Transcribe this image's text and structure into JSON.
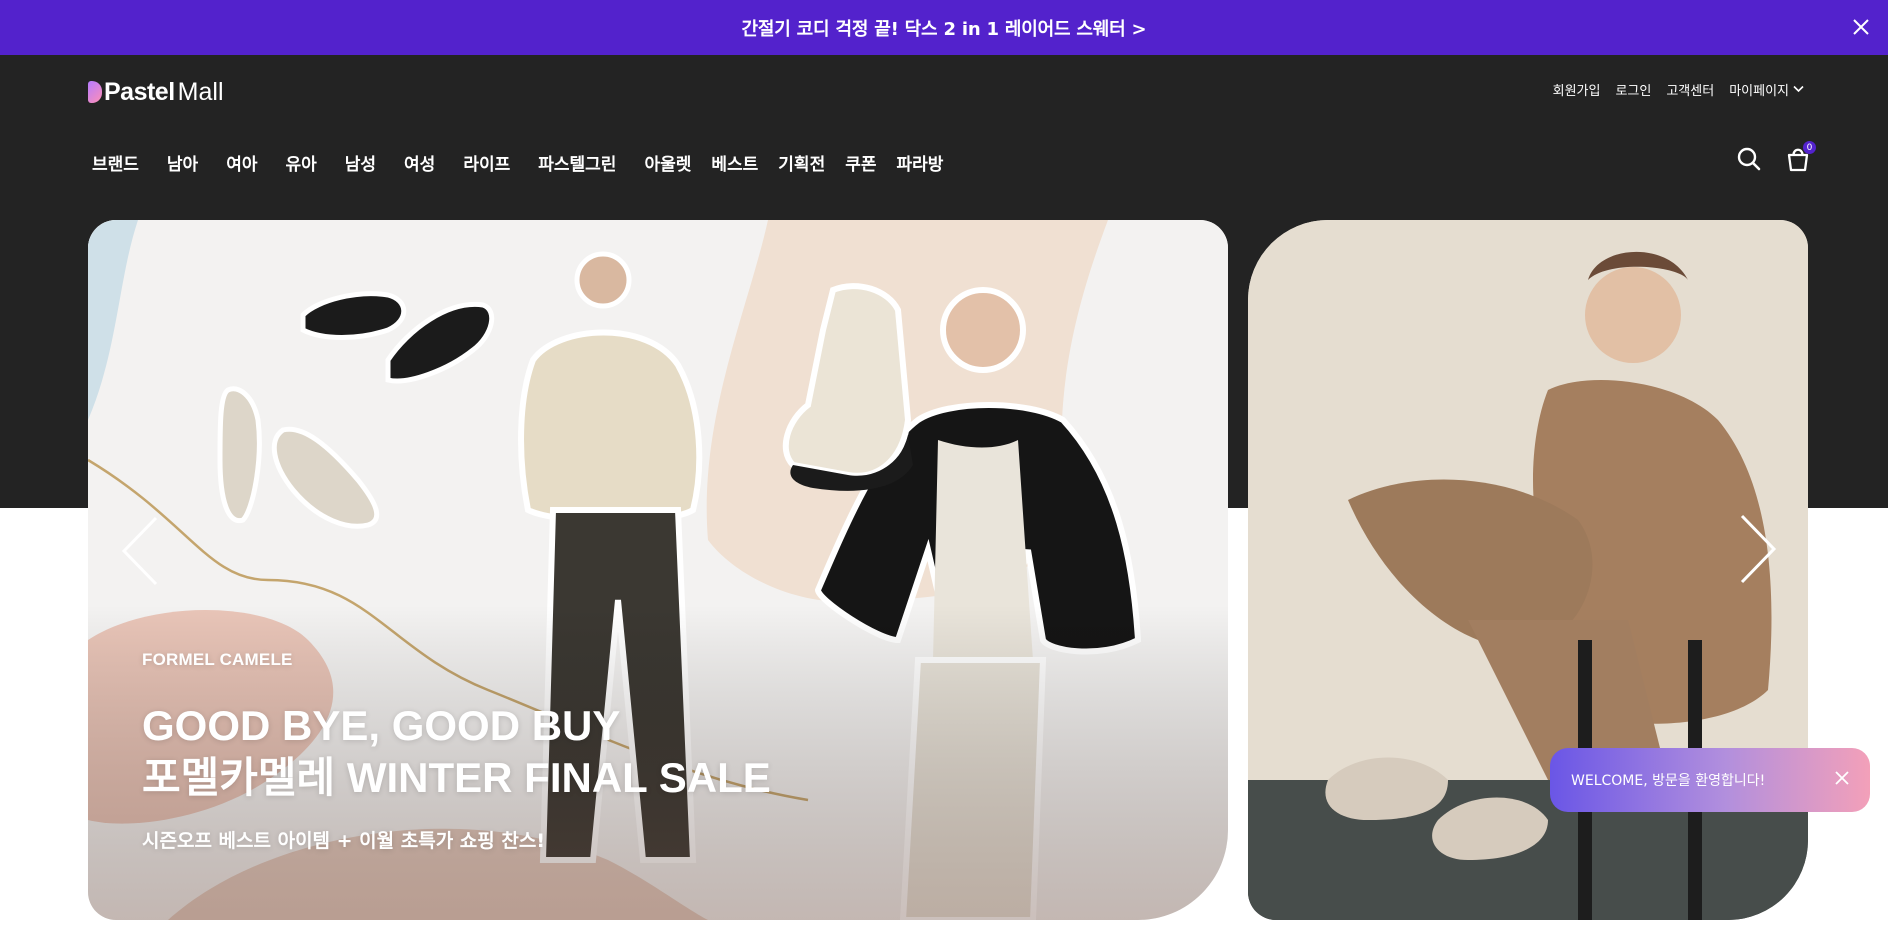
{
  "promo_bar": {
    "text": "간절기 코디 걱정 끝! 닥스 2 in 1 레이어드 스웨터 >"
  },
  "logo": {
    "pastel": "Pastel",
    "mall": "Mall"
  },
  "utility_nav": [
    {
      "label": "회원가입"
    },
    {
      "label": "로그인"
    },
    {
      "label": "고객센터"
    },
    {
      "label": "마이페이지"
    }
  ],
  "main_nav": [
    {
      "label": "브랜드"
    },
    {
      "label": "남아"
    },
    {
      "label": "여아"
    },
    {
      "label": "유아"
    },
    {
      "label": "남성"
    },
    {
      "label": "여성"
    },
    {
      "label": "라이프"
    },
    {
      "label": "파스텔그린"
    },
    {
      "label": "아울렛"
    },
    {
      "label": "베스트"
    },
    {
      "label": "기획전"
    },
    {
      "label": "쿠폰"
    },
    {
      "label": "파라방"
    }
  ],
  "cart": {
    "count": "0"
  },
  "hero": {
    "brand": "FORMEL CAMELE",
    "title_line1": "GOOD BYE, GOOD BUY",
    "title_line2": "포멜카멜레 WINTER FINAL SALE",
    "subtitle": "시즌오프 베스트 아이템 + 이월 초특가 쇼핑 찬스!"
  },
  "toast": {
    "text": "WELCOME, 방문을 환영합니다!"
  },
  "icons": {
    "search": "search-icon",
    "cart": "shopping-bag-icon",
    "close": "close-icon",
    "prev": "chevron-left-icon",
    "next": "chevron-right-icon",
    "dropdown": "chevron-down-icon"
  },
  "colors": {
    "promo_bg": "#5322cc",
    "header_bg": "#232323",
    "badge": "#5322cc",
    "toast_start": "#6a56e6",
    "toast_end": "#f3a0b9"
  }
}
